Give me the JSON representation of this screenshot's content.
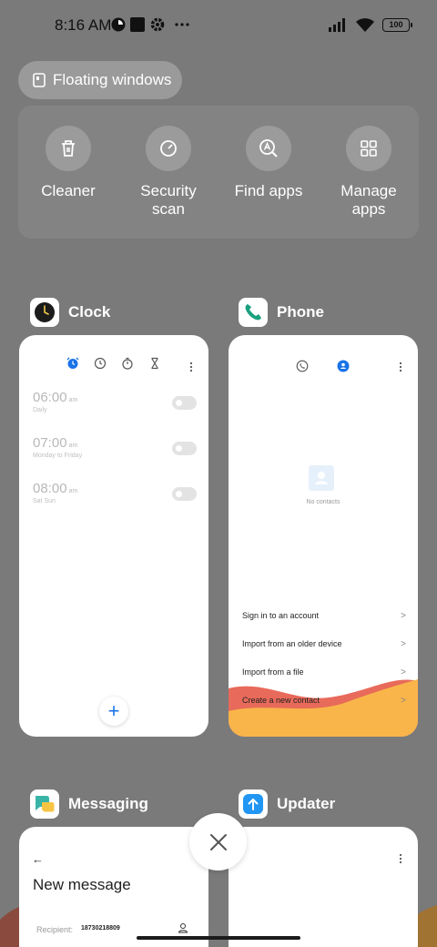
{
  "status_bar": {
    "time": "8:16 AM",
    "battery": "100",
    "icons": [
      "notification-icon",
      "square-icon",
      "gear-icon",
      "more-dots-icon",
      "signal-icon",
      "wifi-icon",
      "battery-icon"
    ]
  },
  "floating_windows": {
    "label": "Floating windows",
    "icon": "floating-window-icon"
  },
  "quick_actions": [
    {
      "label": "Cleaner",
      "icon": "trash-icon"
    },
    {
      "label": "Security scan",
      "icon": "security-scan-icon"
    },
    {
      "label": "Find apps",
      "icon": "find-apps-icon"
    },
    {
      "label": "Manage apps",
      "icon": "grid-icon"
    }
  ],
  "apps": {
    "clock": {
      "title": "Clock",
      "tabs": [
        "alarm-icon",
        "clock-icon",
        "stopwatch-icon",
        "timer-icon"
      ],
      "alarms": [
        {
          "time": "06:00",
          "ampm": "am",
          "repeat": "Daily",
          "enabled": false
        },
        {
          "time": "07:00",
          "ampm": "am",
          "repeat": "Monday to Friday",
          "enabled": false
        },
        {
          "time": "08:00",
          "ampm": "am",
          "repeat": "Sat Sun",
          "enabled": false
        }
      ],
      "fab": "+"
    },
    "phone": {
      "title": "Phone",
      "empty_label": "No contacts",
      "items": [
        "Sign in to an account",
        "Import from an older device",
        "Import from a file",
        "Create a new contact"
      ]
    },
    "messaging": {
      "title": "Messaging",
      "heading": "New message",
      "recipient_label": "Recipient:",
      "recipient_value": "18730218809"
    },
    "updater": {
      "title": "Updater"
    }
  },
  "colors": {
    "background": "#7a7a7a",
    "accent": "#1a73e8",
    "phone_green": "#1aa07f",
    "updater_blue": "#2196f3",
    "wave_red": "#e86a5a",
    "wave_orange": "#f9b54a"
  }
}
